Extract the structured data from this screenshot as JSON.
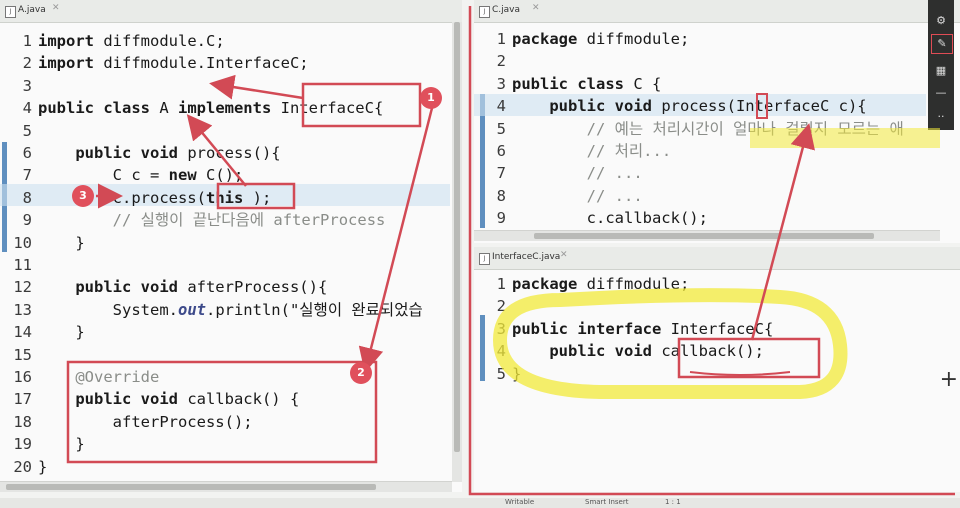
{
  "colors": {
    "annotation": "#d24a55",
    "highlighter": "#f2ea3a",
    "selection": "#cde1f0",
    "gutter_marker": "#5f8fbf"
  },
  "editor_left": {
    "tab_label": "A.java",
    "lines": [
      {
        "n": "1",
        "segs": [
          [
            "kw",
            "import"
          ],
          [
            "",
            "diffmodule.C;"
          ]
        ]
      },
      {
        "n": "2",
        "segs": [
          [
            "kw",
            "import"
          ],
          [
            "",
            "diffmodule.InterfaceC;"
          ]
        ]
      },
      {
        "n": "3",
        "segs": []
      },
      {
        "n": "4",
        "segs": [
          [
            "kw",
            "public class"
          ],
          [
            "",
            "A"
          ],
          [
            "kw",
            "implements"
          ],
          [
            "",
            "InterfaceC{"
          ]
        ]
      },
      {
        "n": "5",
        "segs": []
      },
      {
        "n": "6",
        "segs": [
          [
            "",
            "    "
          ],
          [
            "kw",
            "public void"
          ],
          [
            "",
            "process(){"
          ]
        ]
      },
      {
        "n": "7",
        "segs": [
          [
            "",
            "        C c = "
          ],
          [
            "kw",
            "new"
          ],
          [
            "",
            "C();"
          ]
        ]
      },
      {
        "n": "8",
        "segs": [
          [
            "",
            "        c.process("
          ],
          [
            "kw",
            "this"
          ],
          [
            "",
            ");"
          ]
        ]
      },
      {
        "n": "9",
        "segs": [
          [
            "cm",
            "        // 실행이 끝난다음에 afterProcess"
          ]
        ]
      },
      {
        "n": "10",
        "segs": [
          [
            "",
            "    }"
          ]
        ]
      },
      {
        "n": "11",
        "segs": []
      },
      {
        "n": "12",
        "segs": [
          [
            "",
            "    "
          ],
          [
            "kw",
            "public void"
          ],
          [
            "",
            "afterProcess(){"
          ]
        ]
      },
      {
        "n": "13",
        "segs": [
          [
            "",
            "        System."
          ],
          [
            "it",
            "out"
          ],
          [
            "",
            ".println(\"실행이 완료되었습"
          ]
        ]
      },
      {
        "n": "14",
        "segs": [
          [
            "",
            "    }"
          ]
        ]
      },
      {
        "n": "15",
        "segs": []
      },
      {
        "n": "16",
        "segs": [
          [
            "cm",
            "    @Override"
          ]
        ]
      },
      {
        "n": "17",
        "segs": [
          [
            "",
            "    "
          ],
          [
            "kw",
            "public void"
          ],
          [
            "",
            "callback() {"
          ]
        ]
      },
      {
        "n": "18",
        "segs": [
          [
            "",
            "        afterProcess();"
          ]
        ]
      },
      {
        "n": "19",
        "segs": [
          [
            "",
            "    }"
          ]
        ]
      },
      {
        "n": "20",
        "segs": [
          [
            "",
            "}"
          ]
        ]
      }
    ]
  },
  "editor_right_top": {
    "tab_label": "C.java",
    "lines": [
      {
        "n": "1",
        "segs": [
          [
            "kw",
            "package"
          ],
          [
            "",
            "diffmodule;"
          ]
        ]
      },
      {
        "n": "2",
        "segs": []
      },
      {
        "n": "3",
        "segs": [
          [
            "kw",
            "public class"
          ],
          [
            "",
            "C {"
          ]
        ]
      },
      {
        "n": "4",
        "segs": [
          [
            "",
            "    "
          ],
          [
            "kw",
            "public void"
          ],
          [
            "",
            "process(InterfaceC c){"
          ]
        ]
      },
      {
        "n": "5",
        "segs": [
          [
            "cm",
            "        // 예는 처리시간이 얼마나 걸릴지 모르는 애"
          ]
        ]
      },
      {
        "n": "6",
        "segs": [
          [
            "cm",
            "        // 처리..."
          ]
        ]
      },
      {
        "n": "7",
        "segs": [
          [
            "cm",
            "        // ..."
          ]
        ]
      },
      {
        "n": "8",
        "segs": [
          [
            "cm",
            "        // ..."
          ]
        ]
      },
      {
        "n": "9",
        "segs": [
          [
            "",
            "        c.callback();"
          ]
        ]
      }
    ]
  },
  "editor_right_bottom": {
    "tab_label": "InterfaceC.java",
    "lines": [
      {
        "n": "1",
        "segs": [
          [
            "kw",
            "package"
          ],
          [
            "",
            "diffmodule;"
          ]
        ]
      },
      {
        "n": "2",
        "segs": []
      },
      {
        "n": "3",
        "segs": [
          [
            "kw",
            "public interface"
          ],
          [
            "",
            "InterfaceC{"
          ]
        ]
      },
      {
        "n": "4",
        "segs": [
          [
            "",
            "    "
          ],
          [
            "kw",
            "public void"
          ],
          [
            "",
            "callback();"
          ]
        ]
      },
      {
        "n": "5",
        "segs": [
          [
            "",
            "}"
          ]
        ]
      }
    ]
  },
  "annotations": {
    "badge_1": "1",
    "badge_2": "2",
    "badge_3": "3"
  },
  "toolbar_icons": [
    "settings-icon",
    "edit-icon",
    "grid-icon",
    "minimize-icon",
    "more-icon"
  ],
  "status": {
    "writable": "Writable",
    "insert_mode": "Smart Insert",
    "position": "1 : 1"
  }
}
